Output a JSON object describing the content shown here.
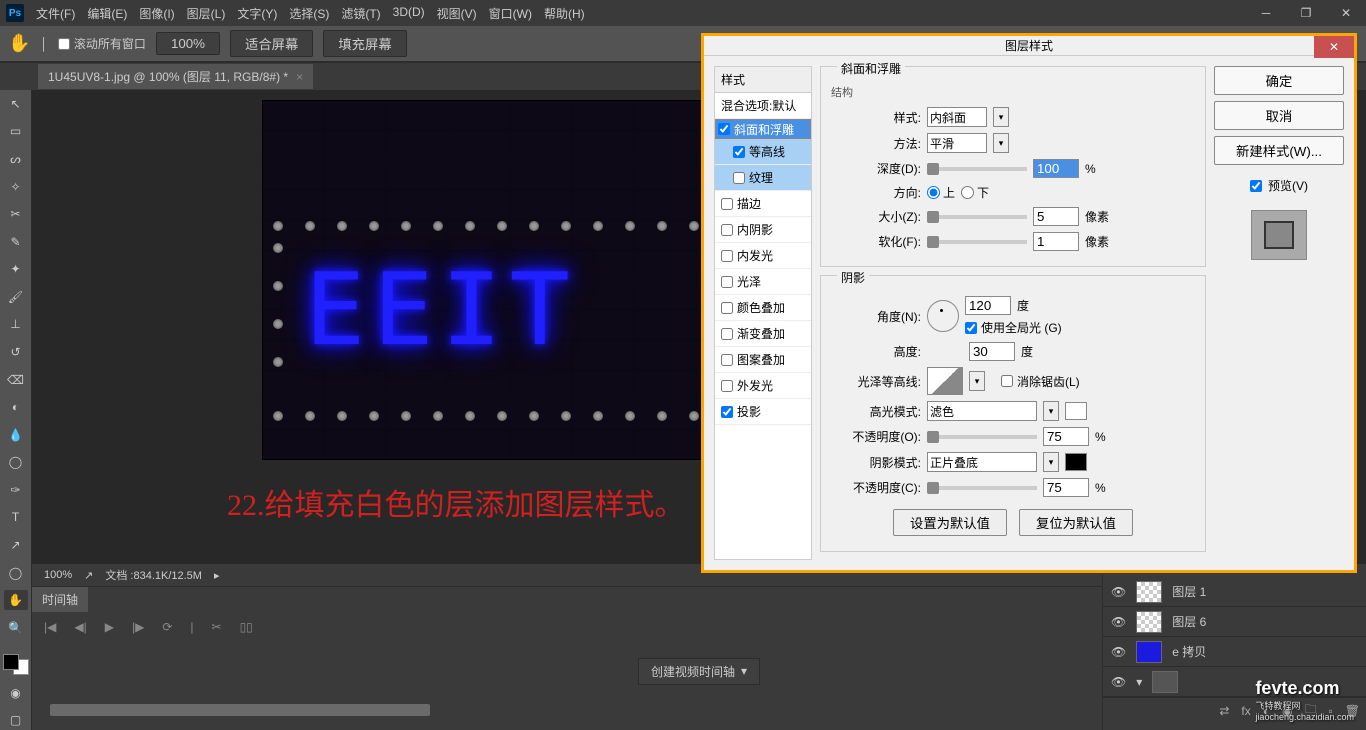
{
  "menu": {
    "file": "文件(F)",
    "edit": "编辑(E)",
    "image": "图像(I)",
    "layer": "图层(L)",
    "type": "文字(Y)",
    "select": "选择(S)",
    "filter": "滤镜(T)",
    "d3": "3D(D)",
    "view": "视图(V)",
    "window": "窗口(W)",
    "help": "帮助(H)"
  },
  "options": {
    "scroll_all": "滚动所有窗口",
    "zoom": "100%",
    "fit": "适合屏幕",
    "fill": "填充屏幕"
  },
  "doc_tab": "1U45UV8-1.jpg @ 100% (图层 11, RGB/8#) *",
  "canvas": {
    "neon_text": "EEIT",
    "annotation": "22.给填充白色的层添加图层样式。"
  },
  "status": {
    "zoom": "100%",
    "doc_info": "文档 :834.1K/12.5M"
  },
  "timeline": {
    "tab": "时间轴",
    "create": "创建视频时间轴"
  },
  "layers": {
    "l1": "图层 1",
    "l2": "图层 6",
    "l3": "e 拷贝"
  },
  "dialog": {
    "title": "图层样式",
    "left": {
      "styles": "样式",
      "blend": "混合选项:默认",
      "bevel": "斜面和浮雕",
      "contour": "等高线",
      "texture": "纹理",
      "stroke": "描边",
      "inner_shadow": "内阴影",
      "inner_glow": "内发光",
      "satin": "光泽",
      "color_ov": "颜色叠加",
      "grad_ov": "渐变叠加",
      "patt_ov": "图案叠加",
      "outer_glow": "外发光",
      "drop_shadow": "投影"
    },
    "section1_title": "斜面和浮雕",
    "section_struct": "结构",
    "style_lbl": "样式:",
    "style_val": "内斜面",
    "method_lbl": "方法:",
    "method_val": "平滑",
    "depth_lbl": "深度(D):",
    "depth_val": "100",
    "depth_unit": "%",
    "direction_lbl": "方向:",
    "dir_up": "上",
    "dir_down": "下",
    "size_lbl": "大小(Z):",
    "size_val": "5",
    "size_unit": "像素",
    "soften_lbl": "软化(F):",
    "soften_val": "1",
    "soften_unit": "像素",
    "section_shadow": "阴影",
    "angle_lbl": "角度(N):",
    "angle_val": "120",
    "angle_unit": "度",
    "global_light": "使用全局光 (G)",
    "altitude_lbl": "高度:",
    "altitude_val": "30",
    "altitude_unit": "度",
    "gloss_lbl": "光泽等高线:",
    "anti_alias": "消除锯齿(L)",
    "highlight_mode_lbl": "高光模式:",
    "highlight_mode_val": "滤色",
    "opacity_lbl": "不透明度(O):",
    "opacity_val": "75",
    "opacity_unit": "%",
    "shadow_mode_lbl": "阴影模式:",
    "shadow_mode_val": "正片叠底",
    "opacity2_lbl": "不透明度(C):",
    "opacity2_val": "75",
    "opacity2_unit": "%",
    "set_default": "设置为默认值",
    "reset_default": "复位为默认值",
    "btn_ok": "确定",
    "btn_cancel": "取消",
    "btn_new_style": "新建样式(W)...",
    "preview": "预览(V)"
  },
  "watermark": {
    "brand": "fevte.com",
    "sub1": "飞特教程网",
    "sub2": "jiaocheng.chazidian.com"
  }
}
